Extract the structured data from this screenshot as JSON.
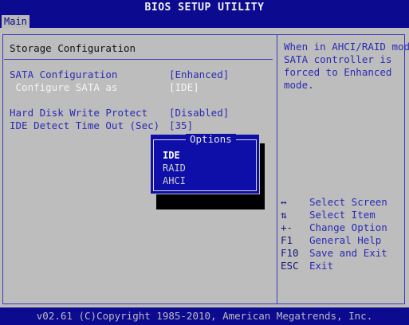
{
  "title": "BIOS SETUP UTILITY",
  "tabs": [
    {
      "label": "Main"
    }
  ],
  "section_title": "Storage Configuration",
  "settings": [
    {
      "label": "SATA Configuration",
      "value": "[Enhanced]"
    },
    {
      "label": " Configure SATA as",
      "value": "[IDE]"
    },
    {
      "label": "Hard Disk Write Protect",
      "value": "[Disabled]"
    },
    {
      "label": "IDE Detect Time Out (Sec)",
      "value": "[35]"
    }
  ],
  "help_text": "When in AHCI/RAID mode\nSATA controller is\nforced to Enhanced\nmode.",
  "popup": {
    "title": "Options",
    "options": [
      "IDE",
      "RAID",
      "AHCI"
    ],
    "selected": "IDE"
  },
  "keys": [
    {
      "key": "↔",
      "desc": "Select Screen"
    },
    {
      "key": "⇅",
      "desc": "Select Item"
    },
    {
      "key": "+-",
      "desc": "Change Option"
    },
    {
      "key": "F1",
      "desc": "General Help"
    },
    {
      "key": "F10",
      "desc": "Save and Exit"
    },
    {
      "key": "ESC",
      "desc": "Exit"
    }
  ],
  "footer": "v02.61 (C)Copyright 1985-2010, American Megatrends, Inc.",
  "colors": {
    "background": "#0c0a8f",
    "panel": "#bdbdbd",
    "text_blue": "#2a2cb4",
    "highlight": "#f4f4f4"
  }
}
